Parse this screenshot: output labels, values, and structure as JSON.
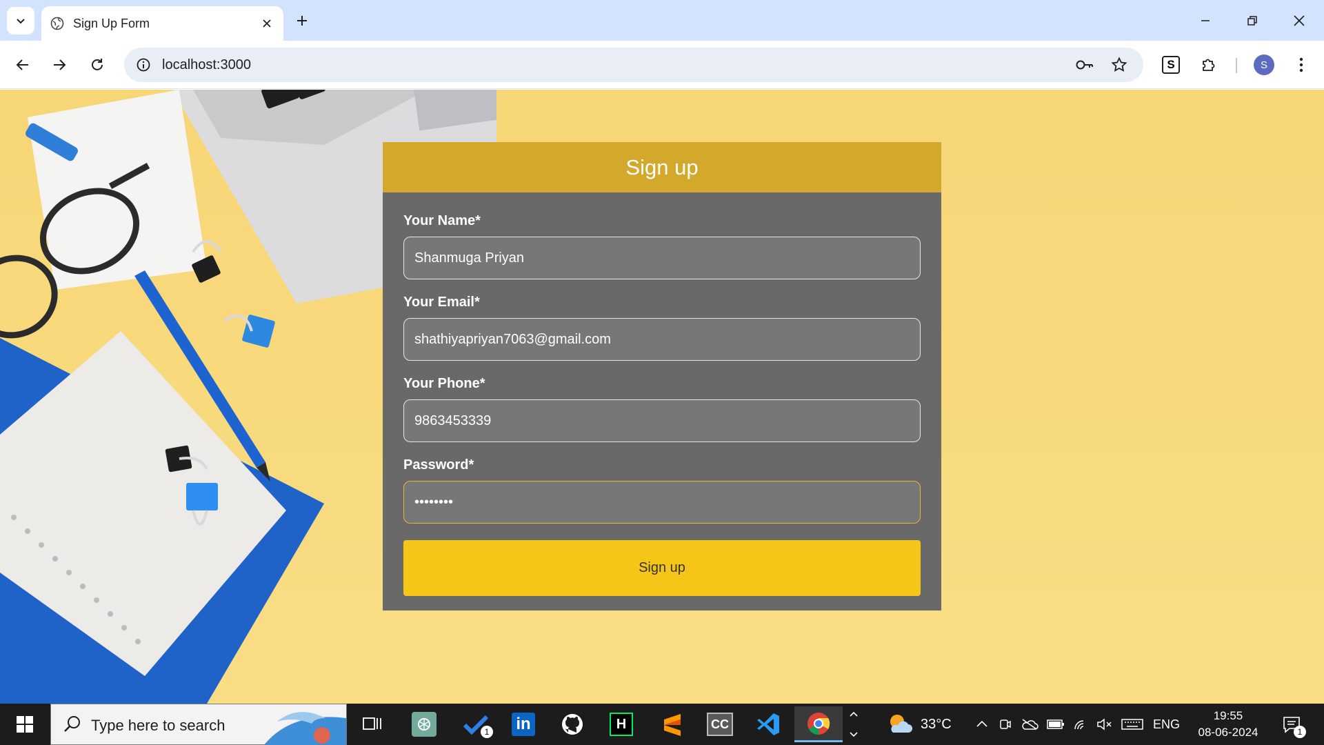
{
  "browser": {
    "tab_title": "Sign Up Form",
    "url": "localhost:3000",
    "profile_initial": "S",
    "extension_letter": "S"
  },
  "form": {
    "title": "Sign up",
    "fields": [
      {
        "label": "Your Name*",
        "value": "Shanmuga Priyan"
      },
      {
        "label": "Your Email*",
        "value": "shathiyapriyan7063@gmail.com"
      },
      {
        "label": "Your Phone*",
        "value": "9863453339"
      },
      {
        "label": "Password*",
        "value": "••••••••"
      }
    ],
    "submit_label": "Sign up"
  },
  "taskbar": {
    "search_placeholder": "Type here to search",
    "weather_temp": "33°C",
    "language": "ENG",
    "time": "19:55",
    "date": "08-06-2024",
    "todo_badge": "1",
    "notification_badge": "1"
  },
  "colors": {
    "header": "#d4a82a",
    "card": "#696969",
    "button": "#f5c518",
    "page_bg": "#f8d97c"
  }
}
